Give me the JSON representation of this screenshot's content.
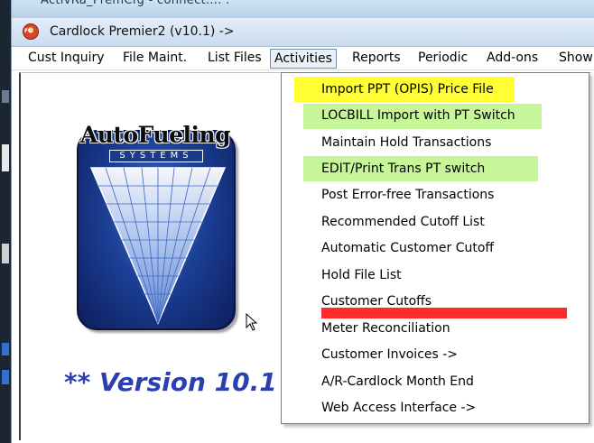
{
  "window": {
    "obscured_title": "ActivRa_PremCfg - connect.... .",
    "title": "Cardlock Premier2 (v10.1) ->",
    "icon_label": "FG"
  },
  "menubar": {
    "items": [
      {
        "label": "Cust Inquiry"
      },
      {
        "label": "File Maint."
      },
      {
        "label": "List Files"
      },
      {
        "label": "Activities",
        "active": true
      },
      {
        "label": "Reports"
      },
      {
        "label": "Periodic"
      },
      {
        "label": "Add-ons"
      },
      {
        "label": "Show"
      }
    ]
  },
  "logo": {
    "word": "AutoFueling",
    "sub": "SYSTEMS"
  },
  "version_text": "** Version 10.1",
  "dropdown": {
    "items": [
      {
        "label": "Import PPT (OPIS) Price File",
        "highlight": "#ffff33"
      },
      {
        "label": "LOCBILL Import with PT Switch",
        "highlight": "#c6f59a"
      },
      {
        "label": "Maintain Hold Transactions"
      },
      {
        "label": "EDIT/Print Trans PT switch",
        "highlight": "#c6f59a"
      },
      {
        "label": "Post Error-free Transactions"
      },
      {
        "label": "Recommended Cutoff List"
      },
      {
        "label": "Automatic Customer Cutoff"
      },
      {
        "label": "Hold File List"
      },
      {
        "label": "Customer Cutoffs",
        "strike_mark": "#ff2a2a"
      },
      {
        "label": "Meter Reconciliation"
      },
      {
        "label": "Customer Invoices ->"
      },
      {
        "label": "A/R-Cardlock Month End"
      },
      {
        "label": "Web Access Interface ->"
      }
    ]
  },
  "colors": {
    "logo_blue": "#1c3f96",
    "version_blue": "#2b3fb0",
    "highlight_yellow": "#ffff33",
    "highlight_green": "#c6f59a",
    "red_mark": "#ff2a2a"
  }
}
